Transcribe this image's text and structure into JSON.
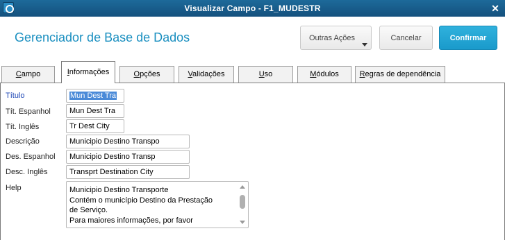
{
  "window": {
    "title": "Visualizar Campo - F1_MUDESTR"
  },
  "header": {
    "heading": "Gerenciador de Base de Dados",
    "buttons": {
      "outras": "Outras Ações",
      "cancelar": "Cancelar",
      "confirmar": "Confirmar"
    }
  },
  "tabs": [
    {
      "label": "Campo",
      "ul": "C",
      "rest": "ampo"
    },
    {
      "label": "Informações",
      "ul": "I",
      "rest": "nformações",
      "active": true
    },
    {
      "label": "Opções",
      "ul": "O",
      "rest": "pções"
    },
    {
      "label": "Validações",
      "ul": "V",
      "rest": "alidações"
    },
    {
      "label": "Uso",
      "ul": "U",
      "rest": "so"
    },
    {
      "label": "Módulos",
      "ul": "M",
      "rest": "ódulos"
    },
    {
      "label": "Regras de dependência",
      "ul": "R",
      "rest": "egras de dependência"
    }
  ],
  "form": {
    "titulo": {
      "label": "Título",
      "value": "Mun Dest Tra"
    },
    "tit_espanhol": {
      "label": "Tít. Espanhol",
      "value": "Mun Dest Tra"
    },
    "tit_ingles": {
      "label": "Tít. Inglês",
      "value": "Tr Dest City"
    },
    "descricao": {
      "label": "Descrição",
      "value": "Municipio Destino Transpo"
    },
    "des_espanhol": {
      "label": "Des. Espanhol",
      "value": "Municipio Destino Transp"
    },
    "desc_ingles": {
      "label": "Desc. Inglês",
      "value": "Transprt Destination City"
    },
    "help": {
      "label": "Help",
      "lines": [
        "Municipio Destino Transporte",
        "Contém o município Destino da Prestação",
        "de Serviço.",
        "Para maiores informações, por favor"
      ]
    }
  },
  "colors": {
    "accent": "#1a8fc0",
    "titlebar": "#14507d",
    "confirm": "#1a9acb",
    "label_blue": "#1a44b4"
  }
}
